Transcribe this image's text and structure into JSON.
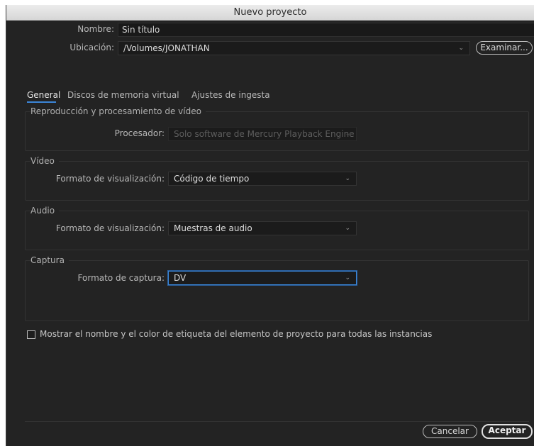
{
  "window": {
    "title": "Nuevo proyecto"
  },
  "name_row": {
    "label": "Nombre:",
    "value": "Sin título"
  },
  "location_row": {
    "label": "Ubicación:",
    "value": "/Volumes/JONATHAN",
    "browse_label": "Examinar..."
  },
  "tabs": [
    {
      "label": "General",
      "active": true
    },
    {
      "label": "Discos de memoria virtual",
      "active": false
    },
    {
      "label": "Ajustes de ingesta",
      "active": false
    }
  ],
  "sections": {
    "playback": {
      "title": "Reproducción y procesamiento de vídeo",
      "processor_label": "Procesador:",
      "processor_value": "Solo software de Mercury Playback Engine"
    },
    "video": {
      "title": "Vídeo",
      "display_label": "Formato de visualización:",
      "display_value": "Código de tiempo"
    },
    "audio": {
      "title": "Audio",
      "display_label": "Formato de visualización:",
      "display_value": "Muestras de audio"
    },
    "capture": {
      "title": "Captura",
      "format_label": "Formato de captura:",
      "format_value": "DV"
    }
  },
  "checkbox": {
    "label": "Mostrar el nombre y el color de etiqueta del elemento de proyecto para todas las instancias",
    "checked": false
  },
  "footer": {
    "cancel_label": "Cancelar",
    "ok_label": "Aceptar"
  },
  "icons": {
    "dropdown": "chevron-down-icon"
  },
  "colors": {
    "accent": "#3b86d8",
    "background": "#232323",
    "field": "#1b1b1b"
  }
}
